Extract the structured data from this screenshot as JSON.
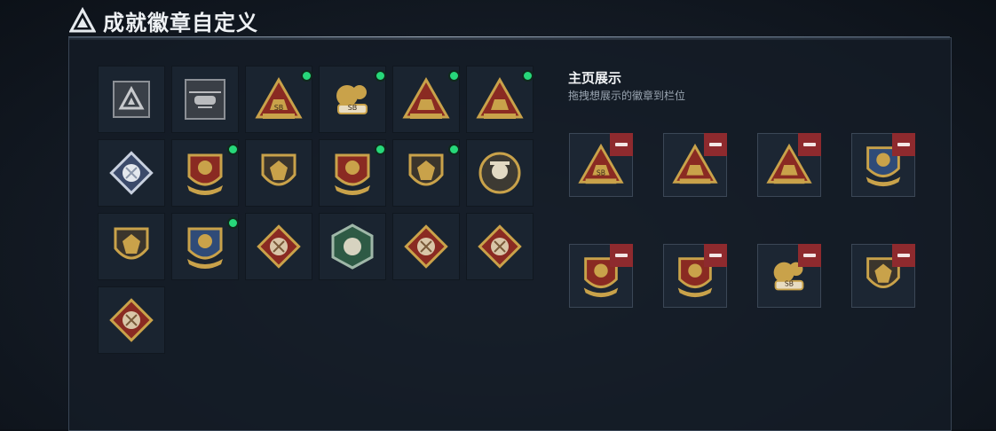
{
  "header": {
    "title": "成就徽章自定义",
    "logo_icon": "triangle-logo-icon"
  },
  "showcase": {
    "title": "主页展示",
    "subtitle": "拖拽想展示的徽章到栏位"
  },
  "colors": {
    "accent_green": "#27d87a",
    "remove_red": "#8e2a2e",
    "gold": "#c9a24a",
    "crimson": "#8a2a22"
  },
  "badges": [
    {
      "icon": "locked-triangle-emblem-icon",
      "unlocked": false
    },
    {
      "icon": "helicopter-badge-icon",
      "unlocked": false
    },
    {
      "icon": "triangle-sb-badge-icon",
      "unlocked": true,
      "label": "SB"
    },
    {
      "icon": "gears-sb-badge-icon",
      "unlocked": true,
      "label": "SB"
    },
    {
      "icon": "triangle-loot-badge-icon",
      "unlocked": true
    },
    {
      "icon": "triangle-soldier-badge-icon",
      "unlocked": true
    },
    {
      "icon": "diamond-rose-badge-icon",
      "unlocked": false
    },
    {
      "icon": "star-medal-badge-icon",
      "unlocked": true
    },
    {
      "icon": "shield-eagle-badge-icon",
      "unlocked": false
    },
    {
      "icon": "winged-shield-stars-badge-icon",
      "unlocked": true
    },
    {
      "icon": "shield-crystal-badge-icon",
      "unlocked": true
    },
    {
      "icon": "round-skull-badge-icon",
      "unlocked": false
    },
    {
      "icon": "shield-blade-badge-icon",
      "unlocked": false
    },
    {
      "icon": "crossed-weapons-shield-badge-icon",
      "unlocked": true
    },
    {
      "icon": "diamond-wolf-badge-icon",
      "unlocked": false
    },
    {
      "icon": "hexagon-goat-badge-icon",
      "unlocked": false
    },
    {
      "icon": "diamond-dragon-badge-icon",
      "unlocked": false
    },
    {
      "icon": "diamond-lizard-badge-icon",
      "unlocked": false
    },
    {
      "icon": "diamond-horse-badge-icon",
      "unlocked": false
    }
  ],
  "slots": [
    {
      "icon": "triangle-sb-badge-icon",
      "label": "SB"
    },
    {
      "icon": "triangle-loot-badge-icon"
    },
    {
      "icon": "triangle-soldier-badge-icon"
    },
    {
      "icon": "crossed-weapons-shield-badge-icon"
    },
    {
      "icon": "star-medal-badge-icon"
    },
    {
      "icon": "winged-shield-stars-badge-icon"
    },
    {
      "icon": "gears-sb-badge-icon",
      "label": "SB"
    },
    {
      "icon": "shield-crystal-badge-icon"
    }
  ]
}
